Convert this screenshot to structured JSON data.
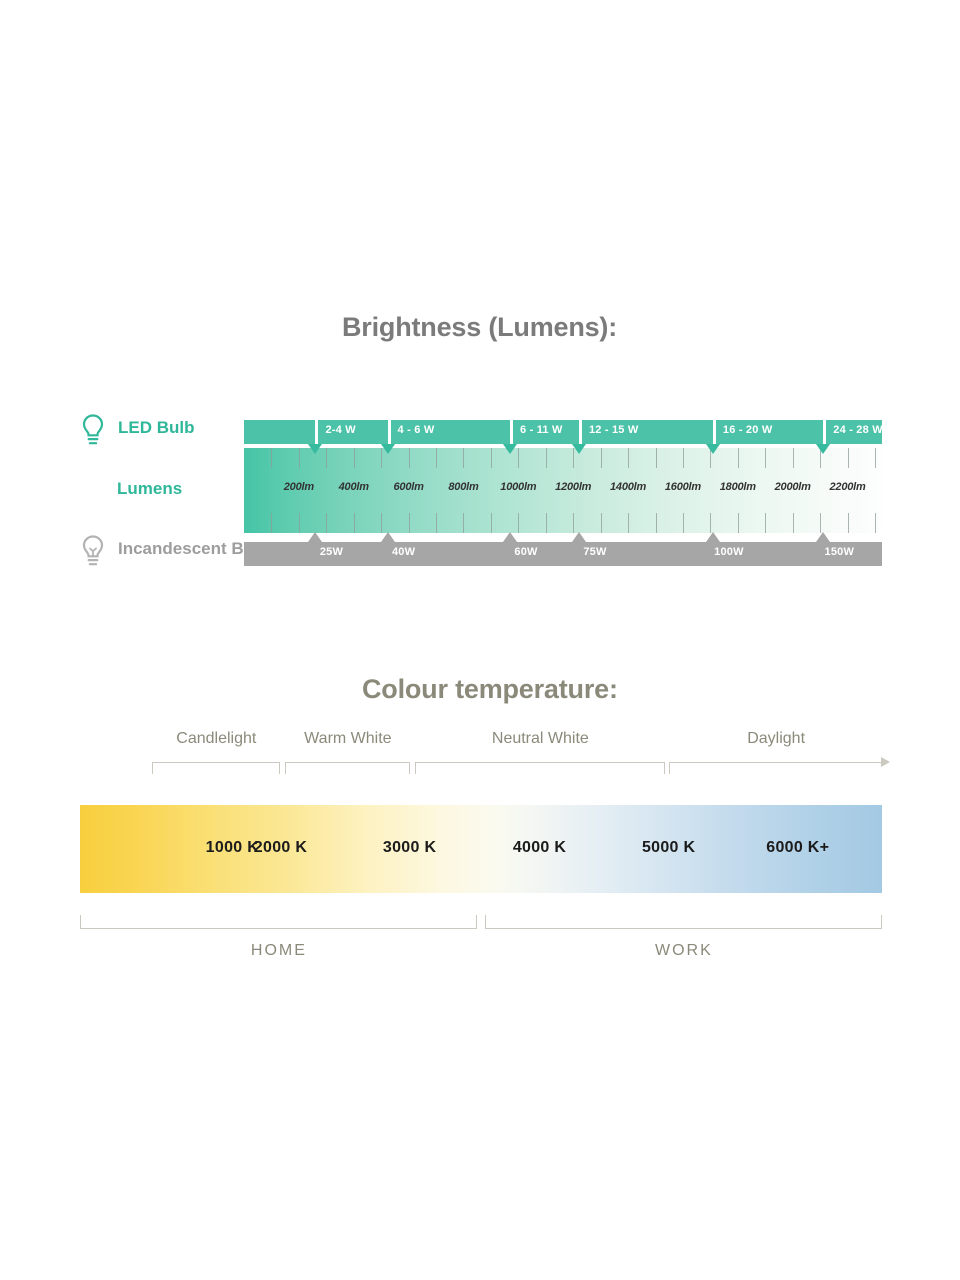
{
  "brightness": {
    "title": "Brightness (Lumens):",
    "rows": {
      "led": {
        "label": "LED Bulb",
        "icon": "lightbulb-filled-icon",
        "color": "#2fb79a"
      },
      "lumens": {
        "label": "Lumens",
        "color": "#2fb79a"
      },
      "incandescent": {
        "label": "Incandescent Bulbt",
        "icon": "lightbulb-outline-icon",
        "color": "#9d9d9d"
      }
    },
    "watt_bar_color": "#4cc2a8",
    "incandescent_bar_color": "#a6a6a6",
    "led_watt_segments": [
      {
        "label": "",
        "start_pct": 0,
        "end_pct": 11.2
      },
      {
        "label": "2-4 W",
        "start_pct": 11.2,
        "end_pct": 22.5
      },
      {
        "label": "4 - 6 W",
        "start_pct": 22.5,
        "end_pct": 41.7
      },
      {
        "label": "6 - 11 W",
        "start_pct": 41.7,
        "end_pct": 52.5
      },
      {
        "label": "12 - 15 W",
        "start_pct": 52.5,
        "end_pct": 73.5
      },
      {
        "label": "16 - 20 W",
        "start_pct": 73.5,
        "end_pct": 90.8
      },
      {
        "label": "24 - 28 W",
        "start_pct": 90.8,
        "end_pct": 100
      }
    ],
    "lumen_labels": [
      {
        "text": "200lm",
        "pct": 8.6
      },
      {
        "text": "400lm",
        "pct": 17.2
      },
      {
        "text": "600lm",
        "pct": 25.8
      },
      {
        "text": "800lm",
        "pct": 34.4
      },
      {
        "text": "1000lm",
        "pct": 43.0
      },
      {
        "text": "1200lm",
        "pct": 51.6
      },
      {
        "text": "1400lm",
        "pct": 60.2
      },
      {
        "text": "1600lm",
        "pct": 68.8
      },
      {
        "text": "1800lm",
        "pct": 77.4
      },
      {
        "text": "2000lm",
        "pct": 86.0
      },
      {
        "text": "2200lm",
        "pct": 94.6
      }
    ],
    "tick_pcts": [
      4.3,
      8.6,
      12.9,
      17.2,
      21.5,
      25.8,
      30.1,
      34.4,
      38.7,
      43.0,
      47.3,
      51.6,
      55.9,
      60.2,
      64.5,
      68.8,
      73.1,
      77.4,
      81.7,
      86.0,
      90.3,
      94.6,
      98.9
    ],
    "led_markers_pct": [
      11.2,
      22.5,
      41.7,
      52.5,
      73.5,
      90.8
    ],
    "incandescent_markers_pct": [
      11.2,
      22.5,
      41.7,
      52.5,
      73.5,
      90.8
    ],
    "incandescent_labels": [
      {
        "text": "25W",
        "pct": 11.2
      },
      {
        "text": "40W",
        "pct": 22.5
      },
      {
        "text": "60W",
        "pct": 41.7
      },
      {
        "text": "75W",
        "pct": 52.5
      },
      {
        "text": "100W",
        "pct": 73.5
      },
      {
        "text": "150W",
        "pct": 90.8
      }
    ]
  },
  "colour_temperature": {
    "title": "Colour temperature:",
    "categories": [
      {
        "label": "Candlelight",
        "center_pct": 17.0,
        "start_pct": 9.0,
        "end_pct": 25.0
      },
      {
        "label": "Warm White",
        "center_pct": 33.4,
        "start_pct": 25.6,
        "end_pct": 41.2
      },
      {
        "label": "Neutral White",
        "center_pct": 57.4,
        "start_pct": 41.8,
        "end_pct": 72.9
      },
      {
        "label": "Daylight",
        "center_pct": 86.8,
        "start_pct": 73.5,
        "end_pct": 100
      }
    ],
    "kelvin_labels": [
      {
        "text": "1000 K",
        "pct": 19.0
      },
      {
        "text": "2000 K",
        "pct": 25.0
      },
      {
        "text": "3000 K",
        "pct": 41.1
      },
      {
        "text": "4000 K",
        "pct": 57.3
      },
      {
        "text": "5000 K",
        "pct": 73.4
      },
      {
        "text": "6000 K+",
        "pct": 89.5
      }
    ],
    "usage": [
      {
        "label": "HOME",
        "start_pct": 0,
        "end_pct": 49.5,
        "center_pct": 24.8
      },
      {
        "label": "WORK",
        "start_pct": 50.5,
        "end_pct": 100,
        "center_pct": 75.3
      }
    ],
    "gradient_start": "#f7cf3e",
    "gradient_end": "#a4c9e3"
  }
}
